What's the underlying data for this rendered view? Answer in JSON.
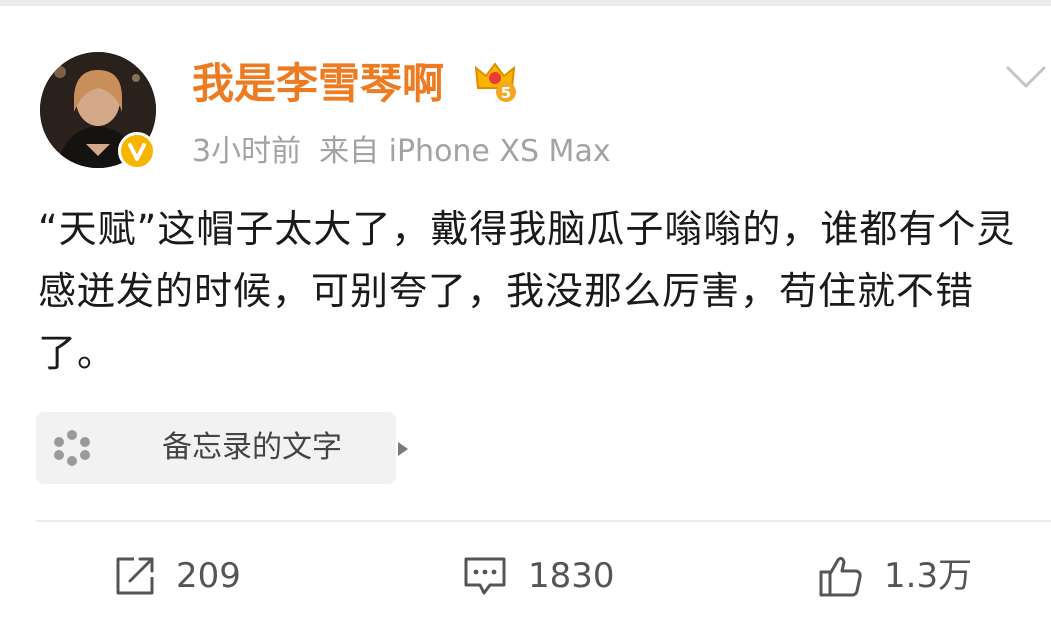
{
  "post": {
    "author": {
      "name": "我是李雪琴啊",
      "avatar_icon": "avatar-photo",
      "verified_icon": "verified-v-badge",
      "member_icon": "crown-vip-badge"
    },
    "time": "3小时前",
    "source": "来自 iPhone XS Max",
    "body": "“天赋”这帽子太大了，戴得我脑瓜子嗡嗡的，谁都有个灵感迸发的时候，可别夸了，我没那么厉害，苟住就不错了。",
    "attachment": {
      "icon": "memo-icon",
      "label": "备忘录的文字",
      "arrow_icon": "play-arrow-icon"
    },
    "menu_icon": "chevron-down-icon"
  },
  "actions": {
    "repost": {
      "icon": "repost-icon",
      "count": "209"
    },
    "comment": {
      "icon": "comment-icon",
      "count": "1830"
    },
    "like": {
      "icon": "thumbs-up-icon",
      "count": "1.3万"
    }
  },
  "colors": {
    "username": "#ee7b21",
    "meta": "#a3a3a3",
    "verified_badge": "#f7b500",
    "attachment_bg": "#f2f2f2",
    "icon_gray": "#555555"
  }
}
